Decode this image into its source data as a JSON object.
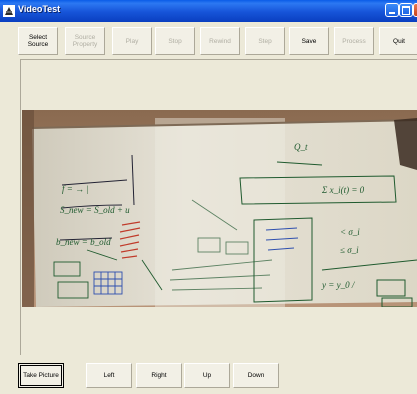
{
  "window": {
    "title": "VideoTest"
  },
  "toolbar": {
    "buttons": [
      {
        "label": "Select\nSource",
        "enabled": true
      },
      {
        "label": "Source\nProperty",
        "enabled": false
      },
      {
        "label": "Play",
        "enabled": false
      },
      {
        "label": "Stop",
        "enabled": false
      },
      {
        "label": "Rewind",
        "enabled": false
      },
      {
        "label": "Step",
        "enabled": false
      },
      {
        "label": "Save",
        "enabled": true
      },
      {
        "label": "Process",
        "enabled": false
      },
      {
        "label": "Quit",
        "enabled": true
      }
    ]
  },
  "video": {
    "whiteboard": {
      "left_eq1": "f = → |",
      "left_eq2": "S_new = S_old + u",
      "left_eq3": "b_new = b_old",
      "right_eq1": "Σ x_i(t) = 0",
      "right_eq2": "< σ_i",
      "right_eq3": "≤ σ_i",
      "right_eq4": "y = y_0 /",
      "right_eq5": "Q_t"
    }
  },
  "bottom": {
    "take_picture": "Take Picture",
    "left": "Left",
    "right": "Right",
    "up": "Up",
    "down": "Down"
  },
  "colors": {
    "titlebar": "#1654D8",
    "face": "#ECE9D8",
    "disabled_text": "#B0AEA3"
  }
}
